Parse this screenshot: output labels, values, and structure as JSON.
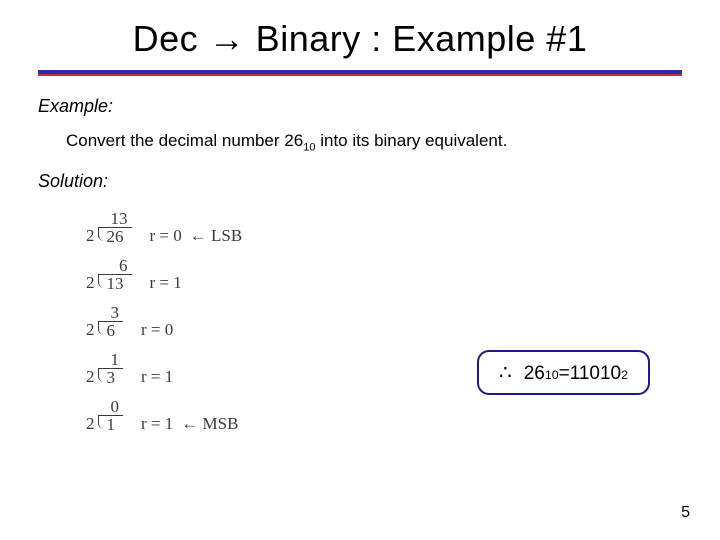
{
  "title": "Dec → Binary : Example #1",
  "exampleLabel": "Example:",
  "prompt": {
    "pre": "Convert the decimal number 26",
    "sub": "10",
    "post": " into its binary equivalent."
  },
  "solutionLabel": "Solution:",
  "steps": [
    {
      "divisor": "2",
      "dividend": "26",
      "quotient": "13",
      "r": "r = 0",
      "note": "← LSB"
    },
    {
      "divisor": "2",
      "dividend": "13",
      "quotient": "6",
      "r": "r = 1",
      "note": ""
    },
    {
      "divisor": "2",
      "dividend": "6",
      "quotient": "3",
      "r": "r = 0",
      "note": ""
    },
    {
      "divisor": "2",
      "dividend": "3",
      "quotient": "1",
      "r": "r = 1",
      "note": ""
    },
    {
      "divisor": "2",
      "dividend": "1",
      "quotient": "0",
      "r": "r = 1",
      "note": "← MSB"
    }
  ],
  "answer": {
    "therefore": "∴",
    "lhs": "26",
    "lsub": "10",
    "eq": " = ",
    "rhs": "11010",
    "rsub": "2"
  },
  "pageNumber": "5"
}
